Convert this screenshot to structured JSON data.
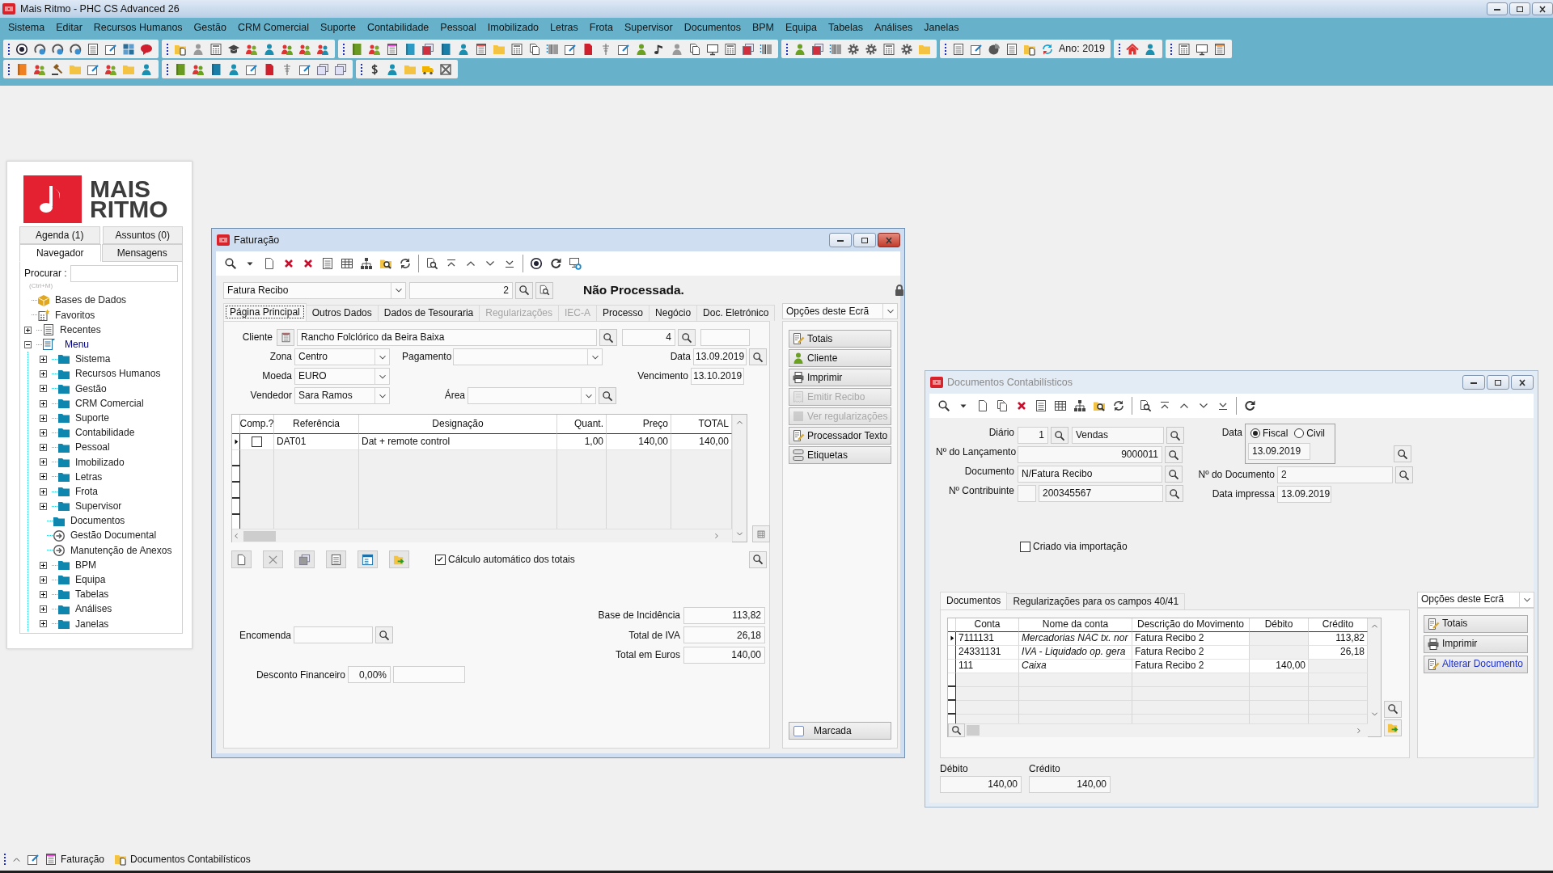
{
  "app": {
    "title": "Mais Ritmo - PHC CS Advanced 26"
  },
  "menu_bar": [
    "Sistema",
    "Editar",
    "Recursos Humanos",
    "Gestão",
    "CRM Comercial",
    "Suporte",
    "Contabilidade",
    "Pessoal",
    "Imobilizado",
    "Letras",
    "Frota",
    "Supervisor",
    "Documentos",
    "BPM",
    "Equipa",
    "Tabelas",
    "Análises",
    "Janelas"
  ],
  "toolbar": {
    "year": "Ano: 2019"
  },
  "navigator": {
    "logo": [
      "MAIS",
      "RITMO"
    ],
    "tab_rows": [
      [
        {
          "label": "Agenda (1)",
          "selected": false
        },
        {
          "label": "Assuntos (0)",
          "selected": false
        }
      ],
      [
        {
          "label": "Navegador",
          "selected": true
        },
        {
          "label": "Mensagens",
          "selected": false
        }
      ]
    ],
    "search": {
      "label": "Procurar :",
      "shortcut": "(Ctrl+M)"
    },
    "tree": [
      {
        "label": "Bases de Dados",
        "kind": "database"
      },
      {
        "label": "Favoritos",
        "kind": "favorites"
      },
      {
        "label": "Recentes",
        "kind": "recent",
        "expanded": false
      },
      {
        "label": "Menu",
        "kind": "menu",
        "expanded": true,
        "children": [
          {
            "label": "Sistema",
            "kind": "folder",
            "expanded": false
          },
          {
            "label": "Recursos Humanos",
            "kind": "folder",
            "expanded": false
          },
          {
            "label": "Gestão",
            "kind": "folder",
            "expanded": false
          },
          {
            "label": "CRM Comercial",
            "kind": "folder",
            "expanded": false
          },
          {
            "label": "Suporte",
            "kind": "folder",
            "expanded": false
          },
          {
            "label": "Contabilidade",
            "kind": "folder",
            "expanded": false
          },
          {
            "label": "Pessoal",
            "kind": "folder",
            "expanded": false
          },
          {
            "label": "Imobilizado",
            "kind": "folder",
            "expanded": false
          },
          {
            "label": "Letras",
            "kind": "folder",
            "expanded": false
          },
          {
            "label": "Frota",
            "kind": "folder",
            "expanded": false
          },
          {
            "label": "Supervisor",
            "kind": "folder",
            "expanded": false
          },
          {
            "label": "Documentos",
            "kind": "folder"
          },
          {
            "label": "Gestão Documental",
            "kind": "link"
          },
          {
            "label": "Manutenção de Anexos",
            "kind": "link"
          },
          {
            "label": "BPM",
            "kind": "folder",
            "expanded": false
          },
          {
            "label": "Equipa",
            "kind": "folder",
            "expanded": false
          },
          {
            "label": "Tabelas",
            "kind": "folder",
            "expanded": false
          },
          {
            "label": "Análises",
            "kind": "folder",
            "expanded": false
          },
          {
            "label": "Janelas",
            "kind": "folder",
            "expanded": false
          }
        ]
      }
    ]
  },
  "faturacao": {
    "title": "Faturação",
    "active": true,
    "document_type": "Fatura Recibo",
    "number": "2",
    "status": "Não Processada.",
    "tabs": [
      {
        "label": "Página Principal",
        "selected": true,
        "disabled": false
      },
      {
        "label": "Outros Dados",
        "selected": false,
        "disabled": false
      },
      {
        "label": "Dados de Tesouraria",
        "selected": false,
        "disabled": false
      },
      {
        "label": "Regularizações",
        "selected": false,
        "disabled": true
      },
      {
        "label": "IEC-A",
        "selected": false,
        "disabled": true
      },
      {
        "label": "Processo",
        "selected": false,
        "disabled": false
      },
      {
        "label": "Negócio",
        "selected": false,
        "disabled": false
      },
      {
        "label": "Doc. Eletrónico",
        "selected": false,
        "disabled": false
      }
    ],
    "client": {
      "label": "Cliente",
      "name": "Rancho Folclórico da Beira Baixa",
      "number": "4"
    },
    "zone": {
      "label": "Zona",
      "value": "Centro"
    },
    "payment": {
      "label": "Pagamento"
    },
    "date": {
      "label": "Data",
      "value": "13.09.2019"
    },
    "currency": {
      "label": "Moeda",
      "value": "EURO"
    },
    "due_date": {
      "label": "Vencimento",
      "value": "13.10.2019"
    },
    "seller": {
      "label": "Vendedor",
      "value": "Sara Ramos"
    },
    "area": {
      "label": "Área"
    },
    "lines": {
      "columns": [
        "Comp.?",
        "Referência",
        "Designação",
        "Quant.",
        "Preço",
        "TOTAL"
      ],
      "rows": [
        {
          "selected": true,
          "compensated": false,
          "reference": "DAT01",
          "designation": "Dat + remote control",
          "quantity": "1,00",
          "price": "140,00",
          "total": "140,00"
        }
      ]
    },
    "auto_totals": {
      "label": "Cálculo automático dos totais",
      "checked": true
    },
    "order": {
      "label": "Encomenda"
    },
    "totals": [
      {
        "label": "Base de Incidência",
        "value": "113,82"
      },
      {
        "label": "Total de IVA",
        "value": "26,18"
      },
      {
        "label": "Total em Euros",
        "value": "140,00"
      }
    ],
    "financial_discount": {
      "label": "Desconto Financeiro",
      "value": "0,00%"
    },
    "options": {
      "label": "Opções deste Ecrã"
    },
    "actions": [
      {
        "label": "Totais",
        "disabled": false
      },
      {
        "label": "Cliente",
        "disabled": false
      },
      {
        "label": "Imprimir",
        "disabled": false
      },
      {
        "label": "Emitir Recibo",
        "disabled": true
      },
      {
        "label": "Ver regularizações",
        "disabled": true
      },
      {
        "label": "Processador Texto",
        "disabled": false
      },
      {
        "label": "Etiquetas",
        "disabled": false
      }
    ],
    "marked": {
      "label": "Marcada",
      "checked": false
    }
  },
  "documentos_contabilisticos": {
    "title": "Documentos Contabilísticos",
    "active": false,
    "journal": {
      "label": "Diário",
      "number": "1",
      "name": "Vendas"
    },
    "entry_number": {
      "label": "Nº do Lançamento",
      "value": "9000011"
    },
    "document": {
      "label": "Documento",
      "value": "N/Fatura Recibo"
    },
    "taxpayer": {
      "label": "Nº Contribuinte",
      "value": "200345567"
    },
    "date": {
      "label": "Data",
      "modes": [
        {
          "label": "Fiscal",
          "selected": true
        },
        {
          "label": "Civil",
          "selected": false
        }
      ],
      "value": "13.09.2019"
    },
    "document_number": {
      "label": "Nº do Documento",
      "value": "2"
    },
    "printed_date": {
      "label": "Data impressa",
      "value": "13.09.2019"
    },
    "imported": {
      "label": "Criado via importação",
      "checked": false
    },
    "tabs": [
      {
        "label": "Documentos",
        "selected": true
      },
      {
        "label": "Regularizações para os campos 40/41",
        "selected": false
      }
    ],
    "entries": {
      "columns": [
        "Conta",
        "Nome da conta",
        "Descrição do Movimento",
        "Débito",
        "Crédito"
      ],
      "rows": [
        {
          "selected": true,
          "account": "7111131",
          "account_name": "Mercadorias NAC tx. nor",
          "description": "Fatura Recibo 2",
          "credit": "113,82"
        },
        {
          "selected": false,
          "account": "24331131",
          "account_name": "IVA - Liquidado op. gera",
          "description": "Fatura Recibo 2",
          "credit": "26,18"
        },
        {
          "selected": false,
          "account": "111",
          "account_name": "Caixa",
          "description": "Fatura Recibo 2",
          "debit": "140,00"
        }
      ]
    },
    "options": {
      "label": "Opções deste Ecrã"
    },
    "actions": [
      {
        "label": "Totais",
        "kind": "button"
      },
      {
        "label": "Imprimir",
        "kind": "button"
      },
      {
        "label": "Alterar Documento",
        "kind": "link"
      }
    ],
    "debit_total": {
      "label": "Débito",
      "value": "140,00"
    },
    "credit_total": {
      "label": "Crédito",
      "value": "140,00"
    }
  },
  "taskbar": [
    {
      "label": "Faturação",
      "kind": "form"
    },
    {
      "label": "Documentos Contabilísticos",
      "kind": "folder"
    }
  ]
}
